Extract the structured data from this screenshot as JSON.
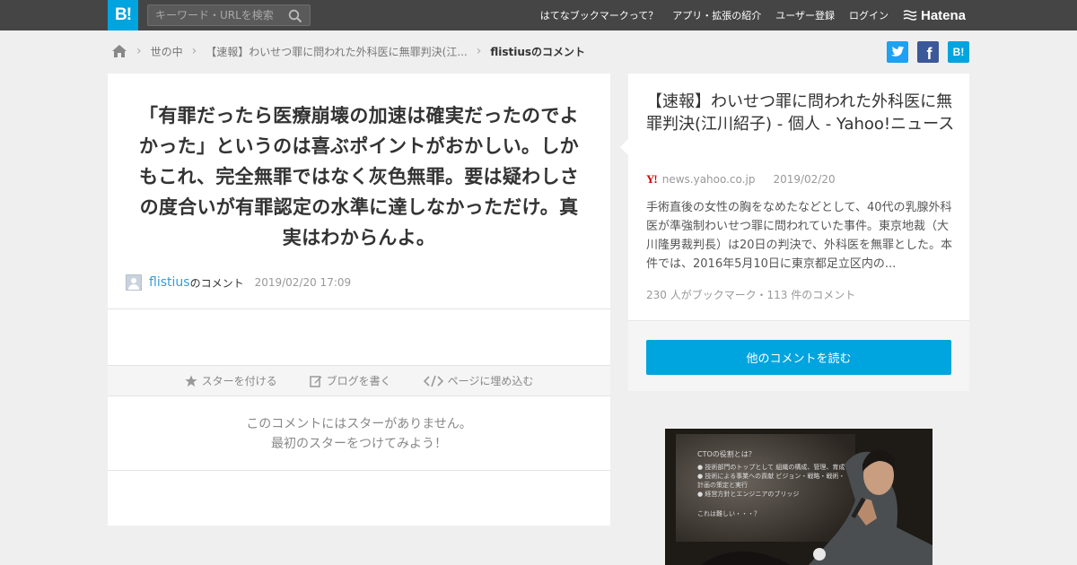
{
  "header": {
    "logo": "B!",
    "search_placeholder": "キーワード・URLを検索",
    "nav": [
      "はてなブックマークって？",
      "アプリ・拡張の紹介",
      "ユーザー登録",
      "ログイン"
    ],
    "brand": "Hatena"
  },
  "breadcrumb": {
    "items": [
      "世の中",
      "【速報】わいせつ罪に問われた外科医に無罪判決(江...",
      "flistiusのコメント"
    ]
  },
  "share": {
    "twitter_color": "#1da1f2",
    "facebook_color": "#3b5998",
    "hatena_label": "B!",
    "hatena_color": "#00a4de"
  },
  "comment": {
    "text": "「有罪だったら医療崩壊の加速は確実だったのでよかった」というのは喜ぶポイントがおかしい。しかもこれ、完全無罪ではなく灰色無罪。要は疑わしさの度合いが有罪認定の水準に達しなかっただけ。真実はわからんよ。",
    "user": "flistius",
    "user_suffix": "のコメント",
    "date": "2019/02/20 17:09"
  },
  "actions": {
    "star": "スターを付ける",
    "blog": "ブログを書く",
    "embed": "ページに埋め込む"
  },
  "stars": {
    "line1": "このコメントにはスターがありません。",
    "line2": "最初のスターをつけてみよう！"
  },
  "article": {
    "title": "【速報】わいせつ罪に問われた外科医に無罪判決(江川紹子) - 個人 - Yahoo!ニュース",
    "source_icon": "Y!",
    "domain": "news.yahoo.co.jp",
    "date": "2019/02/20",
    "description": "手術直後の女性の胸をなめたなどとして、40代の乳腺外科医が準強制わいせつ罪に問われていた事件。東京地裁（大川隆男裁判長）は20日の判決で、外科医を無罪とした。本件では、2016年5月10日に東京都足立区内の...",
    "stats": "230 人がブックマーク・113 件のコメント",
    "read_button": "他のコメントを読む"
  },
  "photo": {
    "slide_title": "CTOの役割とは？",
    "slide_lines": [
      "● 技術部門のトップとして 組織の構成、管理、育成",
      "● 技術による事業への貢献 ビジョン・戦略・戦術・計画の策定と実行",
      "● 経営方針とエンジニアのブリッジ"
    ],
    "slide_footer": "これは難しい・・・？"
  }
}
